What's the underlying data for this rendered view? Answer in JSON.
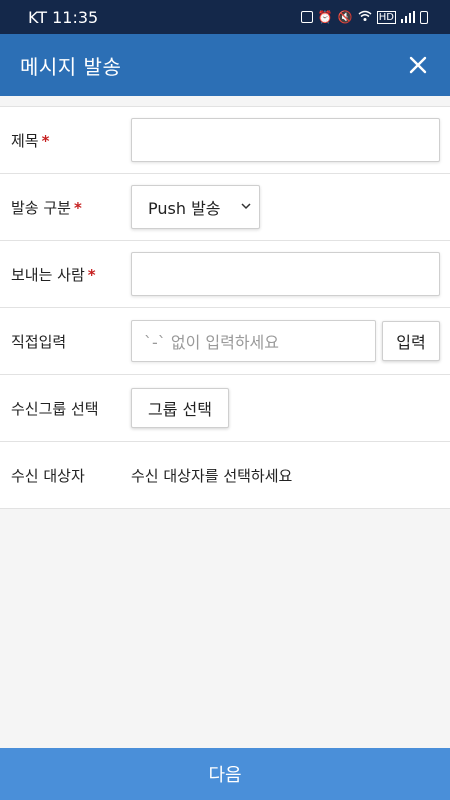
{
  "status_bar": {
    "carrier_time": "KT 11:35"
  },
  "header": {
    "title": "메시지 발송",
    "close_icon": "close-icon"
  },
  "form": {
    "subject": {
      "label": "제목",
      "required_mark": "*",
      "value": ""
    },
    "send_type": {
      "label": "발송 구분",
      "required_mark": "*",
      "selected": "Push 발송"
    },
    "sender": {
      "label": "보내는 사람",
      "required_mark": "*",
      "value": ""
    },
    "direct_input": {
      "label": "직접입력",
      "placeholder": "`-` 없이 입력하세요",
      "button_label": "입력"
    },
    "group": {
      "label": "수신그룹 선택",
      "button_label": "그룹 선택"
    },
    "recipients": {
      "label": "수신 대상자",
      "value": "수신 대상자를 선택하세요"
    }
  },
  "footer": {
    "next_label": "다음"
  },
  "colors": {
    "status_bar": "#14284a",
    "header": "#2c6fb5",
    "next_button": "#4a8fd9",
    "required": "#c62020"
  }
}
